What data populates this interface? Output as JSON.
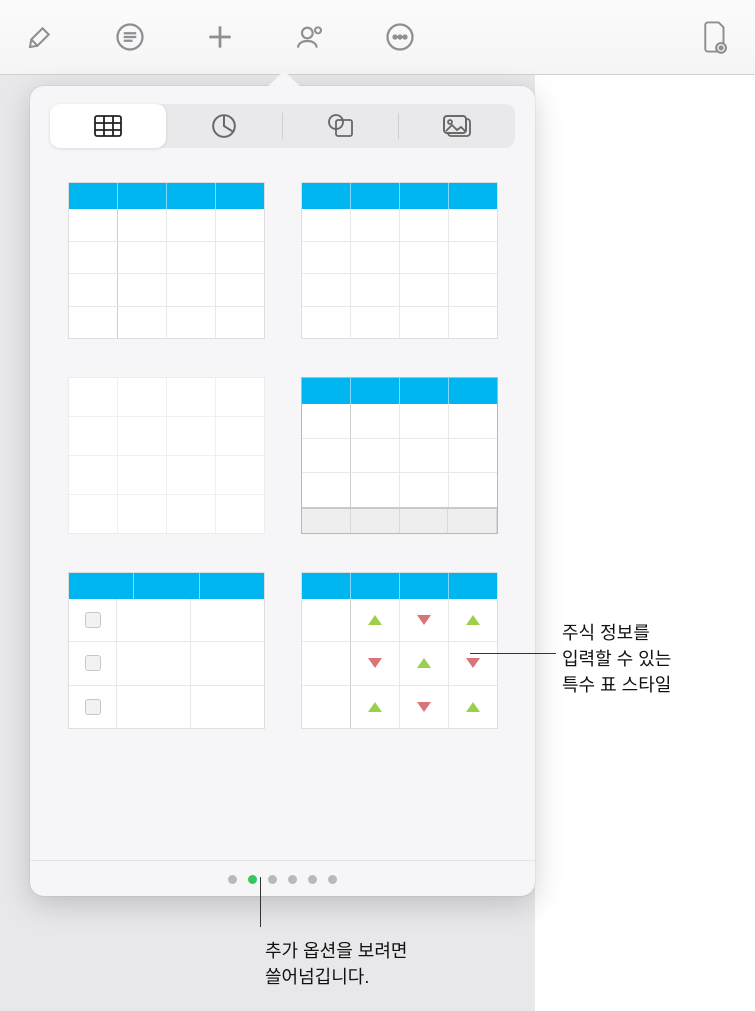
{
  "toolbar": {
    "buttons": [
      "format-brush-icon",
      "outline-icon",
      "add-icon",
      "collaborate-icon",
      "more-icon",
      "document-options-icon"
    ]
  },
  "popover": {
    "tabs": [
      {
        "name": "tables-tab",
        "icon": "table-icon",
        "active": true
      },
      {
        "name": "charts-tab",
        "icon": "pie-chart-icon",
        "active": false
      },
      {
        "name": "shapes-tab",
        "icon": "shape-icon",
        "active": false
      },
      {
        "name": "media-tab",
        "icon": "media-icon",
        "active": false
      }
    ],
    "page_dots": {
      "count": 6,
      "active_index": 1
    },
    "table_styles": [
      {
        "id": "style-header-firstcol",
        "header": true,
        "first_col": "line"
      },
      {
        "id": "style-header-plain",
        "header": true,
        "first_col": "none"
      },
      {
        "id": "style-plain-faint",
        "header": false,
        "first_col": "none"
      },
      {
        "id": "style-header-footer",
        "header": true,
        "first_col": "line",
        "footer": true
      },
      {
        "id": "style-header-checkbox",
        "header": true,
        "first_col": "checkbox"
      },
      {
        "id": "style-header-stock",
        "header": true,
        "first_col": "line",
        "stock": true
      }
    ],
    "stock_grid": [
      [
        "up",
        "dn",
        "up"
      ],
      [
        "dn",
        "up",
        "dn"
      ],
      [
        "up",
        "dn",
        "up"
      ]
    ]
  },
  "callouts": {
    "stock_table": "주식 정보를\n입력할 수 있는\n특수 표 스타일",
    "swipe_hint": "추가 옵션을 보려면\n쓸어넘깁니다."
  }
}
